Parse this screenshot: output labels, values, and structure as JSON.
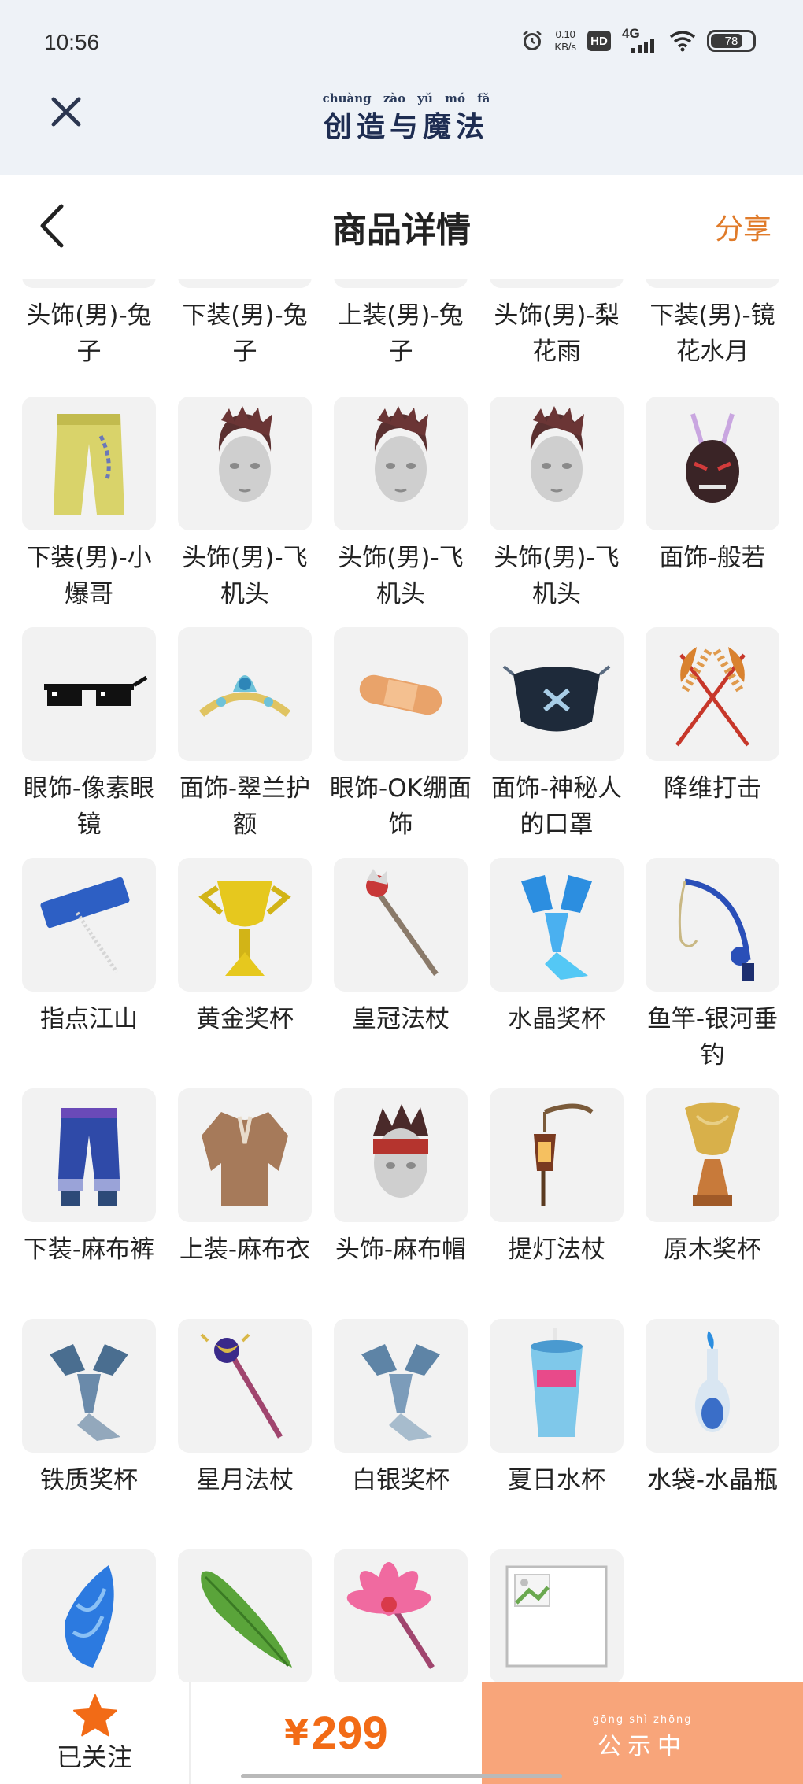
{
  "status_bar": {
    "time": "10:56",
    "net_speed_value": "0.10",
    "net_speed_unit": "KB/s",
    "hd": "HD",
    "network": "4G",
    "battery": "78",
    "icons": [
      "alarm-icon",
      "hd-icon",
      "signal-icon",
      "wifi-icon",
      "battery-icon"
    ]
  },
  "app_header": {
    "logo_pinyin": [
      "chuàng",
      "zào",
      "yǔ",
      "mó",
      "fǎ"
    ],
    "logo_text": "创造与魔法"
  },
  "page_header": {
    "title": "商品详情",
    "share": "分享"
  },
  "items_top_partial": [
    {
      "name": "头饰(男)-兔子"
    },
    {
      "name": "下装(男)-兔子"
    },
    {
      "name": "上装(男)-兔子"
    },
    {
      "name": "头饰(男)-梨花雨"
    },
    {
      "name": "下装(男)-镜花水月"
    }
  ],
  "items": [
    {
      "name": "下装(男)-小爆哥",
      "icon": "yellow-pants"
    },
    {
      "name": "头饰(男)-飞机头",
      "icon": "pompadour-head"
    },
    {
      "name": "头饰(男)-飞机头",
      "icon": "pompadour-head"
    },
    {
      "name": "头饰(男)-飞机头",
      "icon": "pompadour-head"
    },
    {
      "name": "面饰-般若",
      "icon": "hannya-mask"
    },
    {
      "name": "眼饰-像素眼镜",
      "icon": "pixel-glasses"
    },
    {
      "name": "面饰-翠兰护额",
      "icon": "tiara"
    },
    {
      "name": "眼饰-OK绷面饰",
      "icon": "bandage"
    },
    {
      "name": "面饰-神秘人的口罩",
      "icon": "face-mask"
    },
    {
      "name": "降维打击",
      "icon": "crossed-wheat"
    },
    {
      "name": "指点江山",
      "icon": "banner-sign"
    },
    {
      "name": "黄金奖杯",
      "icon": "gold-trophy"
    },
    {
      "name": "皇冠法杖",
      "icon": "crown-staff"
    },
    {
      "name": "水晶奖杯",
      "icon": "crystal-trophy"
    },
    {
      "name": "鱼竿-银河垂钓",
      "icon": "fishing-rod"
    },
    {
      "name": "下装-麻布裤",
      "icon": "linen-pants"
    },
    {
      "name": "上装-麻布衣",
      "icon": "linen-shirt"
    },
    {
      "name": "头饰-麻布帽",
      "icon": "headband-head"
    },
    {
      "name": "提灯法杖",
      "icon": "lantern-staff"
    },
    {
      "name": "原木奖杯",
      "icon": "wood-trophy"
    },
    {
      "name": "铁质奖杯",
      "icon": "iron-trophy"
    },
    {
      "name": "星月法杖",
      "icon": "starmoon-staff"
    },
    {
      "name": "白银奖杯",
      "icon": "silver-trophy"
    },
    {
      "name": "夏日水杯",
      "icon": "summer-cup"
    },
    {
      "name": "水袋-水晶瓶",
      "icon": "crystal-bottle"
    },
    {
      "name": "",
      "icon": "conch"
    },
    {
      "name": "",
      "icon": "green-leaf"
    },
    {
      "name": "",
      "icon": "lotus-staff"
    },
    {
      "name": "",
      "icon": "broken-image"
    }
  ],
  "bottom_bar": {
    "follow_label": "已关注",
    "currency": "¥",
    "price": "299",
    "status_pinyin": "gōng shì zhōng",
    "status_text": "公示中"
  },
  "colors": {
    "accent_orange": "#e07b2a",
    "price_orange": "#f26b16",
    "status_button": "#f8a57a",
    "header_band": "#eef2f7"
  }
}
